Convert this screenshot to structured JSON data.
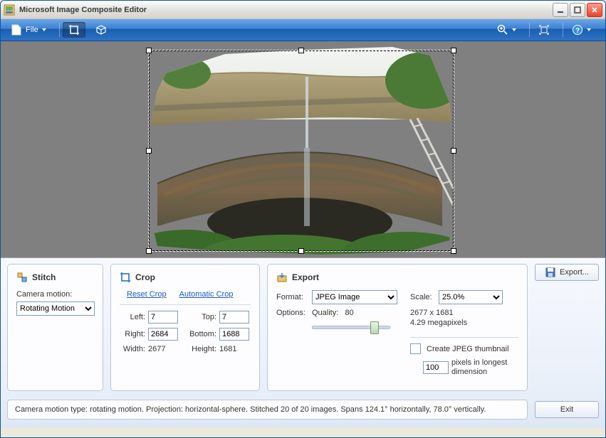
{
  "title": "Microsoft Image Composite Editor",
  "toolbar": {
    "file_label": "File"
  },
  "panels": {
    "stitch": {
      "title": "Stitch",
      "camera_motion_label": "Camera motion:",
      "camera_motion_value": "Rotating Motion"
    },
    "crop": {
      "title": "Crop",
      "reset_link": "Reset Crop",
      "auto_link": "Automatic Crop",
      "left_label": "Left:",
      "left_value": "7",
      "top_label": "Top:",
      "top_value": "7",
      "right_label": "Right:",
      "right_value": "2684",
      "bottom_label": "Bottom:",
      "bottom_value": "1688",
      "width_label": "Width:",
      "width_value": "2677",
      "height_label": "Height:",
      "height_value": "1681"
    },
    "export": {
      "title": "Export",
      "format_label": "Format:",
      "format_value": "JPEG Image",
      "options_label": "Options:",
      "quality_label": "Quality:",
      "quality_value": "80",
      "scale_label": "Scale:",
      "scale_value": "25.0%",
      "dims_text": "2677 x 1681",
      "mp_text": "4.29 megapixels",
      "thumb_label": "Create JPEG thumbnail",
      "thumb_px": "100",
      "thumb_desc": "pixels in longest dimension"
    },
    "export_button": "Export..."
  },
  "status": "Camera motion type: rotating motion. Projection: horizontal-sphere. Stitched 20 of 20 images. Spans 124.1° horizontally, 78.0° vertically.",
  "exit_label": "Exit"
}
